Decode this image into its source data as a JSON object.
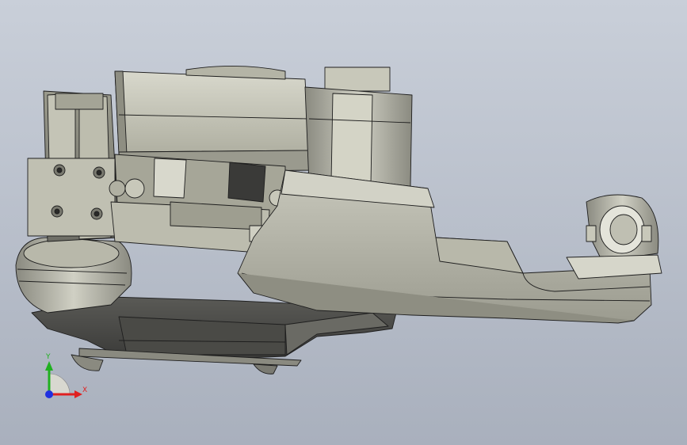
{
  "viewport": {
    "background_top": "#c9cfd9",
    "background_bottom": "#a9b0bd"
  },
  "model": {
    "body_color": "#a8a89a",
    "highlight_color": "#d6d6c8",
    "shadow_color": "#5c5c57",
    "edge_color": "#1e1e1e"
  },
  "triad": {
    "x_label": "X",
    "y_label": "Y",
    "x_color": "#e02020",
    "y_color": "#20b020",
    "z_color": "#2030e0"
  }
}
